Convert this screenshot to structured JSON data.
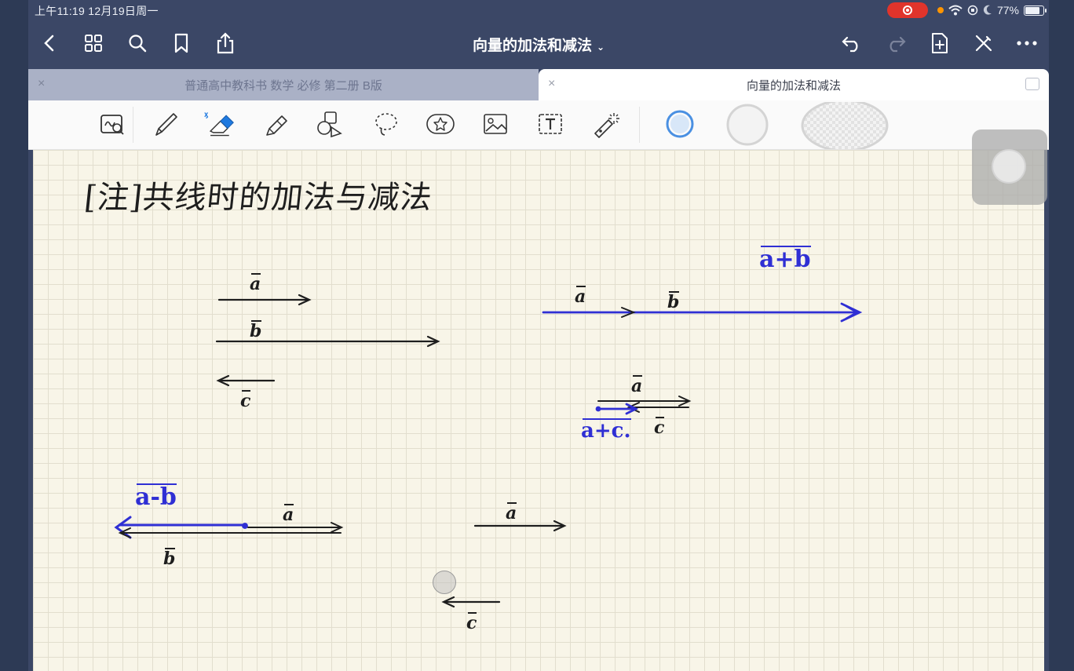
{
  "status_bar": {
    "time": "上午11:19   12月19日周一",
    "battery_percent": "77%"
  },
  "nav": {
    "doc_title": "向量的加法和减法",
    "title_chevron": "⌄"
  },
  "tabs": [
    {
      "label": "普通高中教科书 数学 必修 第二册 B版",
      "close": "×"
    },
    {
      "label": "向量的加法和减法",
      "close": "×"
    }
  ],
  "note": {
    "heading": "[注]共线时的加法与减法",
    "labels": {
      "a1": "a",
      "b1": "b",
      "c1": "c",
      "sum_ab": "a+b",
      "a2": "a",
      "b2": "b",
      "a3": "a",
      "sum_ac": "a+c.",
      "c3": "c",
      "diff_ab": "a-b",
      "a4": "a",
      "b4": "b",
      "a5": "a",
      "c5": "c"
    }
  },
  "colors": {
    "ink_black": "#1e1e1e",
    "ink_blue": "#2f2fd4",
    "paper": "#f8f5e8",
    "chrome": "#3b4766"
  }
}
